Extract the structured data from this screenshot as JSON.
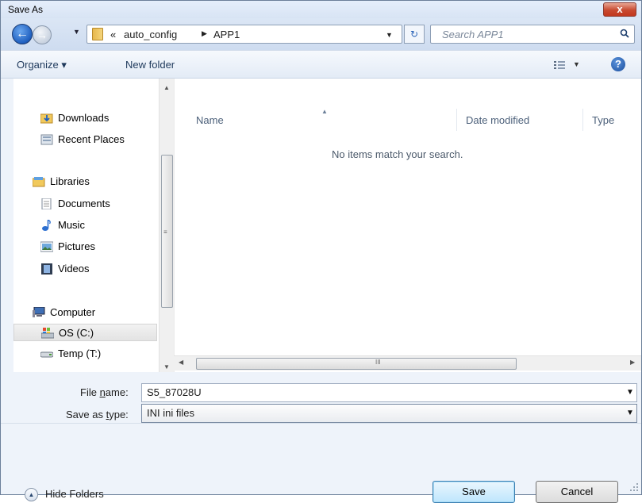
{
  "window": {
    "title": "Save As",
    "close_label": "x"
  },
  "nav": {
    "back_glyph": "←",
    "forward_glyph": "→",
    "history_glyph": "▼",
    "breadcrumb_chevron": "«",
    "breadcrumb": [
      "auto_config",
      "APP1"
    ],
    "breadcrumb_separator": "▶",
    "address_drop_glyph": "▼",
    "refresh_glyph": "↻",
    "search_placeholder": "Search APP1"
  },
  "toolbar": {
    "organize_label": "Organize ▾",
    "new_folder_label": "New folder",
    "views_drop_glyph": "▼",
    "help_glyph": "?"
  },
  "sidebar": {
    "items": [
      {
        "label": "Downloads",
        "icon": "downloads-folder-icon"
      },
      {
        "label": "Recent Places",
        "icon": "recent-places-icon"
      },
      {
        "label": "Libraries",
        "icon": "libraries-icon"
      },
      {
        "label": "Documents",
        "icon": "documents-icon"
      },
      {
        "label": "Music",
        "icon": "music-icon"
      },
      {
        "label": "Pictures",
        "icon": "pictures-icon"
      },
      {
        "label": "Videos",
        "icon": "videos-icon"
      },
      {
        "label": "Computer",
        "icon": "computer-icon"
      },
      {
        "label": "OS (C:)",
        "icon": "local-drive-icon",
        "selected": true
      },
      {
        "label": "Temp (T:)",
        "icon": "network-drive-icon"
      }
    ]
  },
  "file_list": {
    "columns": [
      "Name",
      "Date modified",
      "Type"
    ],
    "empty_message": "No items match your search."
  },
  "form": {
    "file_name_label_pre": "File ",
    "file_name_label_key": "n",
    "file_name_label_post": "ame:",
    "file_name_value": "S5_87028U",
    "save_type_label_pre": "Save as ",
    "save_type_label_key": "t",
    "save_type_label_post": "ype:",
    "save_type_value": "INI ini files",
    "drop_glyph": "▼"
  },
  "footer": {
    "hide_folders_label": "Hide Folders",
    "hide_glyph": "▲",
    "save_label": "Save",
    "cancel_label": "Cancel"
  },
  "scrollbars": {
    "up": "▲",
    "down": "▼",
    "left": "◀",
    "right": "▶",
    "grip_v": "≡",
    "grip_h": "III"
  },
  "colors": {
    "window_bg": "#eef3fa",
    "accent": "#1f5fbf",
    "close_red": "#c84a30"
  }
}
